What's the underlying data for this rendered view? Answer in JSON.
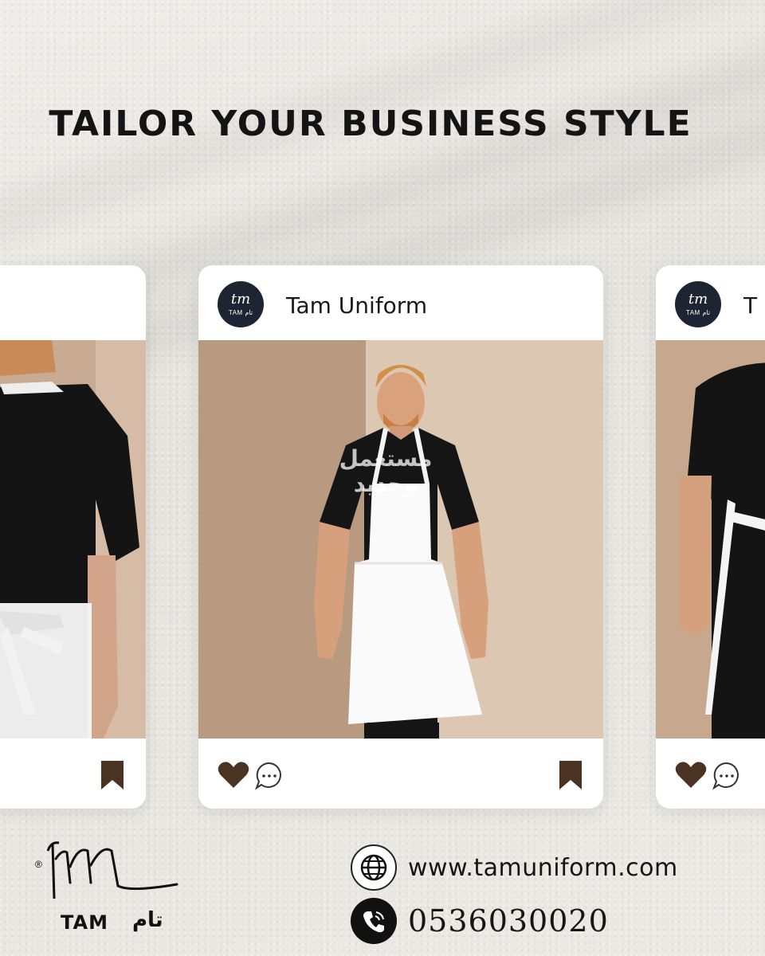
{
  "headline": "TAILOR YOUR BUSINESS STYLE",
  "post": {
    "handle": "Tam Uniform",
    "handle_truncated": "T",
    "avatar_monogram": "tm",
    "avatar_caption": "TAM تام"
  },
  "watermark": "مستعمل وجديد",
  "brand": {
    "registered": "®",
    "monogram": "tm",
    "name_latin": "TAM",
    "name_arabic": "تام"
  },
  "contact": {
    "website": "www.tamuniform.com",
    "phone": "0536030020",
    "website_icon": "globe-icon",
    "phone_icon": "phone-icon"
  },
  "colors": {
    "icon_brown": "#4a3322",
    "avatar_navy": "#1d2533",
    "background": "#e9e7e2"
  }
}
